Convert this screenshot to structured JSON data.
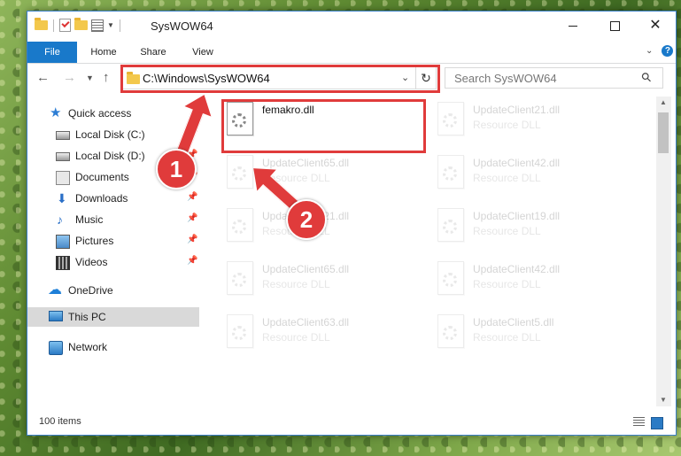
{
  "window": {
    "title": "SysWOW64"
  },
  "ribbon": {
    "tabs": [
      "File",
      "Home",
      "Share",
      "View"
    ]
  },
  "address": {
    "path": "C:\\Windows\\SysWOW64"
  },
  "search": {
    "placeholder": "Search SysWOW64"
  },
  "sidebar": {
    "items": [
      {
        "label": "Quick access",
        "icon": "star-icon"
      },
      {
        "label": "Local Disk (C:)",
        "icon": "disk-icon"
      },
      {
        "label": "Local Disk (D:)",
        "icon": "disk-icon"
      },
      {
        "label": "Documents",
        "icon": "documents-icon"
      },
      {
        "label": "Downloads",
        "icon": "downloads-icon"
      },
      {
        "label": "Music",
        "icon": "music-icon"
      },
      {
        "label": "Pictures",
        "icon": "pictures-icon"
      },
      {
        "label": "Videos",
        "icon": "videos-icon"
      },
      {
        "label": "OneDrive",
        "icon": "onedrive-icon"
      },
      {
        "label": "This PC",
        "icon": "pc-icon"
      },
      {
        "label": "Network",
        "icon": "network-icon"
      }
    ]
  },
  "files": [
    {
      "name": "femakro.dll",
      "type": ""
    },
    {
      "name": "UpdateClient21.dll",
      "type": "Resource DLL"
    },
    {
      "name": "UpdateClient65.dll",
      "type": "Resource DLL"
    },
    {
      "name": "UpdateClient42.dll",
      "type": "Resource DLL"
    },
    {
      "name": "UpdateClient21.dll",
      "type": "Resource DLL"
    },
    {
      "name": "UpdateClient19.dll",
      "type": "Resource DLL"
    },
    {
      "name": "UpdateClient65.dll",
      "type": "Resource DLL"
    },
    {
      "name": "UpdateClient42.dll",
      "type": "Resource DLL"
    },
    {
      "name": "UpdateClient63.dll",
      "type": "Resource DLL"
    },
    {
      "name": "UpdateClient5.dll",
      "type": "Resource DLL"
    }
  ],
  "status": {
    "items_count": "100 items"
  },
  "callouts": {
    "one": "1",
    "two": "2"
  },
  "colors": {
    "accent": "#1979ca",
    "highlight": "#e03b3b"
  }
}
